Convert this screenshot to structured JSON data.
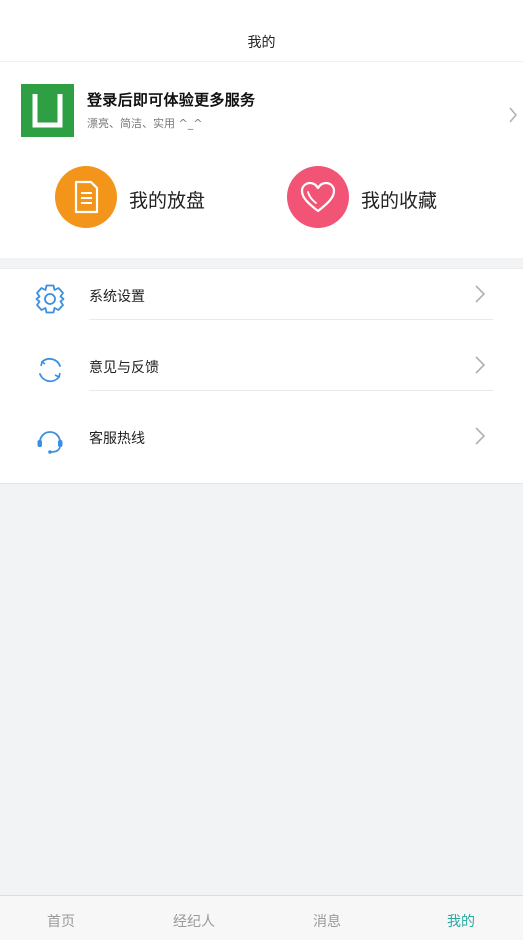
{
  "header": {
    "title": "我的"
  },
  "profile": {
    "title": "登录后即可体验更多服务",
    "subtitle": "漂亮、简洁、实用 ^_^",
    "logo_color": "#2ea043"
  },
  "quick_actions": [
    {
      "label": "我的放盘",
      "icon": "document-icon",
      "color": "#f2951a"
    },
    {
      "label": "我的收藏",
      "icon": "heart-icon",
      "color": "#f25476"
    }
  ],
  "menu": [
    {
      "label": "系统设置",
      "icon": "gear-icon"
    },
    {
      "label": "意见与反馈",
      "icon": "refresh-icon"
    },
    {
      "label": "客服热线",
      "icon": "headset-icon"
    }
  ],
  "tabbar": {
    "items": [
      {
        "label": "首页"
      },
      {
        "label": "经纪人"
      },
      {
        "label": "消息"
      },
      {
        "label": "我的"
      }
    ],
    "active": "我的",
    "active_color": "#2aa8a0"
  }
}
